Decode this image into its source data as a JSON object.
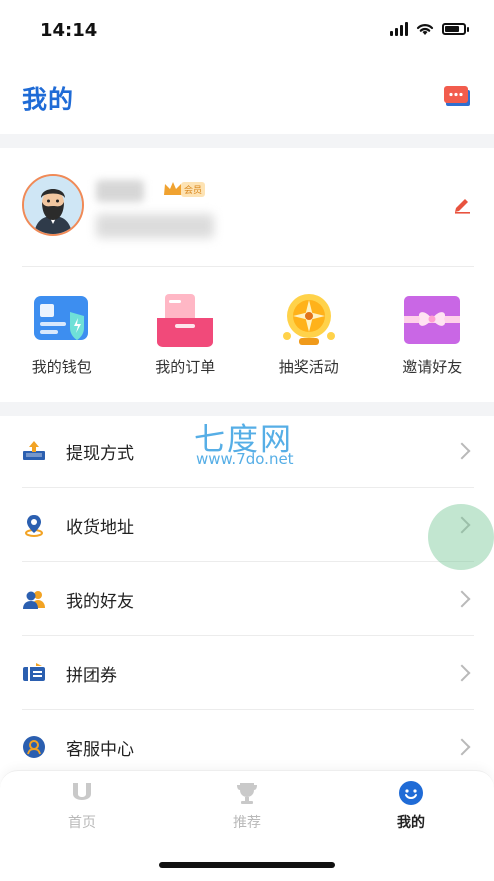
{
  "status": {
    "time": "14:14"
  },
  "header": {
    "title": "我的",
    "message_icon": "message-chat-icon"
  },
  "profile": {
    "vip_badge": "会员",
    "edit_icon": "edit-pencil-icon"
  },
  "quick_actions": [
    {
      "label": "我的钱包",
      "icon": "wallet-icon"
    },
    {
      "label": "我的订单",
      "icon": "order-icon"
    },
    {
      "label": "抽奖活动",
      "icon": "lottery-wheel-icon"
    },
    {
      "label": "邀请好友",
      "icon": "gift-icon"
    }
  ],
  "menu": [
    {
      "label": "提现方式",
      "icon": "withdraw-icon"
    },
    {
      "label": "收货地址",
      "icon": "location-pin-icon"
    },
    {
      "label": "我的好友",
      "icon": "friends-icon"
    },
    {
      "label": "拼团券",
      "icon": "coupon-icon"
    },
    {
      "label": "客服中心",
      "icon": "customer-service-icon"
    }
  ],
  "watermark": {
    "name": "七度网",
    "url": "www.7do.net"
  },
  "tabbar": [
    {
      "label": "首页",
      "icon": "home-icon",
      "active": false
    },
    {
      "label": "推荐",
      "icon": "trophy-icon",
      "active": false
    },
    {
      "label": "我的",
      "icon": "smiley-icon",
      "active": true
    }
  ],
  "colors": {
    "accent": "#1f6bd6",
    "edit": "#e8533f"
  }
}
